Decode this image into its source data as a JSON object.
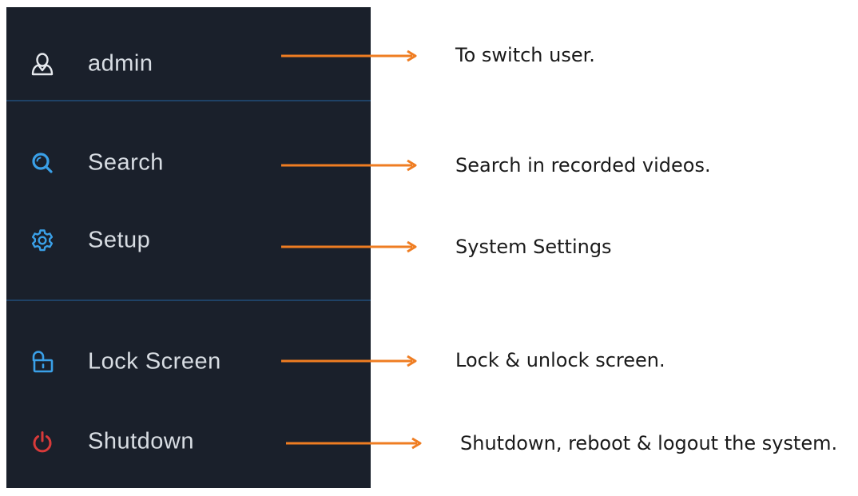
{
  "colors": {
    "panel_background": "#1a202b",
    "divider": "#1f4266",
    "menu_text": "#d8dde3",
    "icon_blue": "#3aa0e8",
    "icon_white": "#e6e9ee",
    "power_red": "#d93a3a",
    "arrow_orange": "#ef7d22",
    "annotation_text": "#1a1a1a"
  },
  "menu": {
    "items": [
      {
        "label": "admin",
        "icon": "user-icon"
      },
      {
        "label": "Search",
        "icon": "search-icon"
      },
      {
        "label": "Setup",
        "icon": "gear-icon"
      },
      {
        "label": "Lock Screen",
        "icon": "unlock-icon"
      },
      {
        "label": "Shutdown",
        "icon": "power-icon"
      }
    ]
  },
  "annotations": [
    {
      "text": "To switch user."
    },
    {
      "text": "Search in recorded videos."
    },
    {
      "text": "System Settings"
    },
    {
      "text": "Lock & unlock screen."
    },
    {
      "text": "Shutdown, reboot & logout the system."
    }
  ]
}
